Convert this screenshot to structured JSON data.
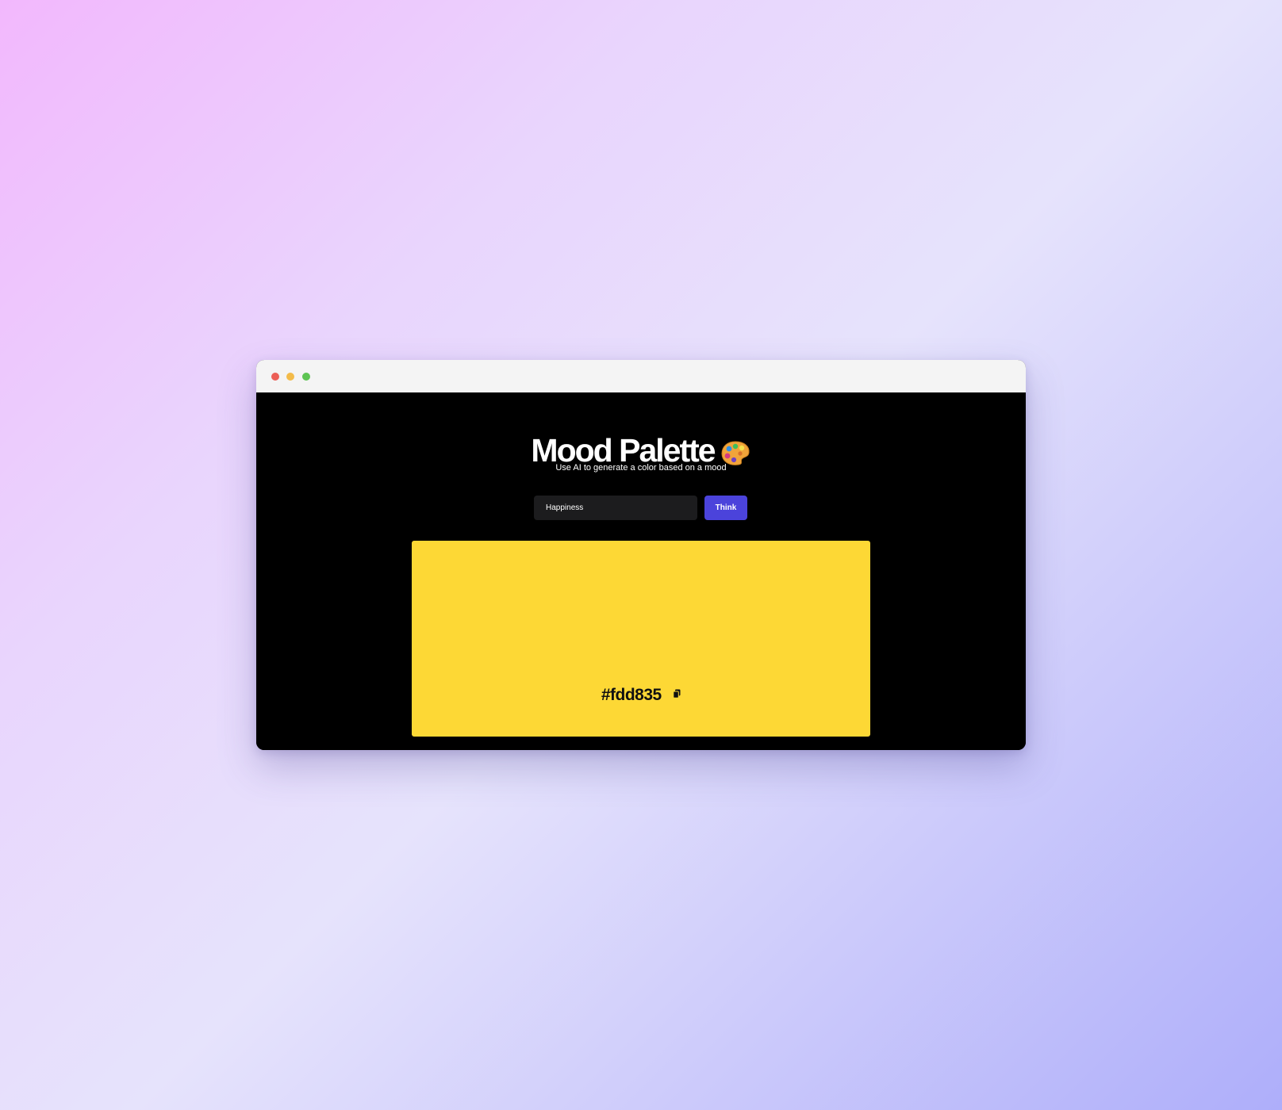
{
  "window": {
    "controls": {
      "close_color": "#ec5f57",
      "minimize_color": "#f3bb4a",
      "maximize_color": "#5ec453"
    }
  },
  "app": {
    "title": "Mood Palette",
    "title_icon": "palette-icon",
    "subtitle": "Use AI to generate a color based on a mood"
  },
  "form": {
    "mood_value": "Happiness",
    "submit_label": "Think",
    "submit_color": "#4b43db"
  },
  "result": {
    "color": "#fdd835",
    "hex_label": "#fdd835",
    "copy_icon": "copy-icon"
  }
}
